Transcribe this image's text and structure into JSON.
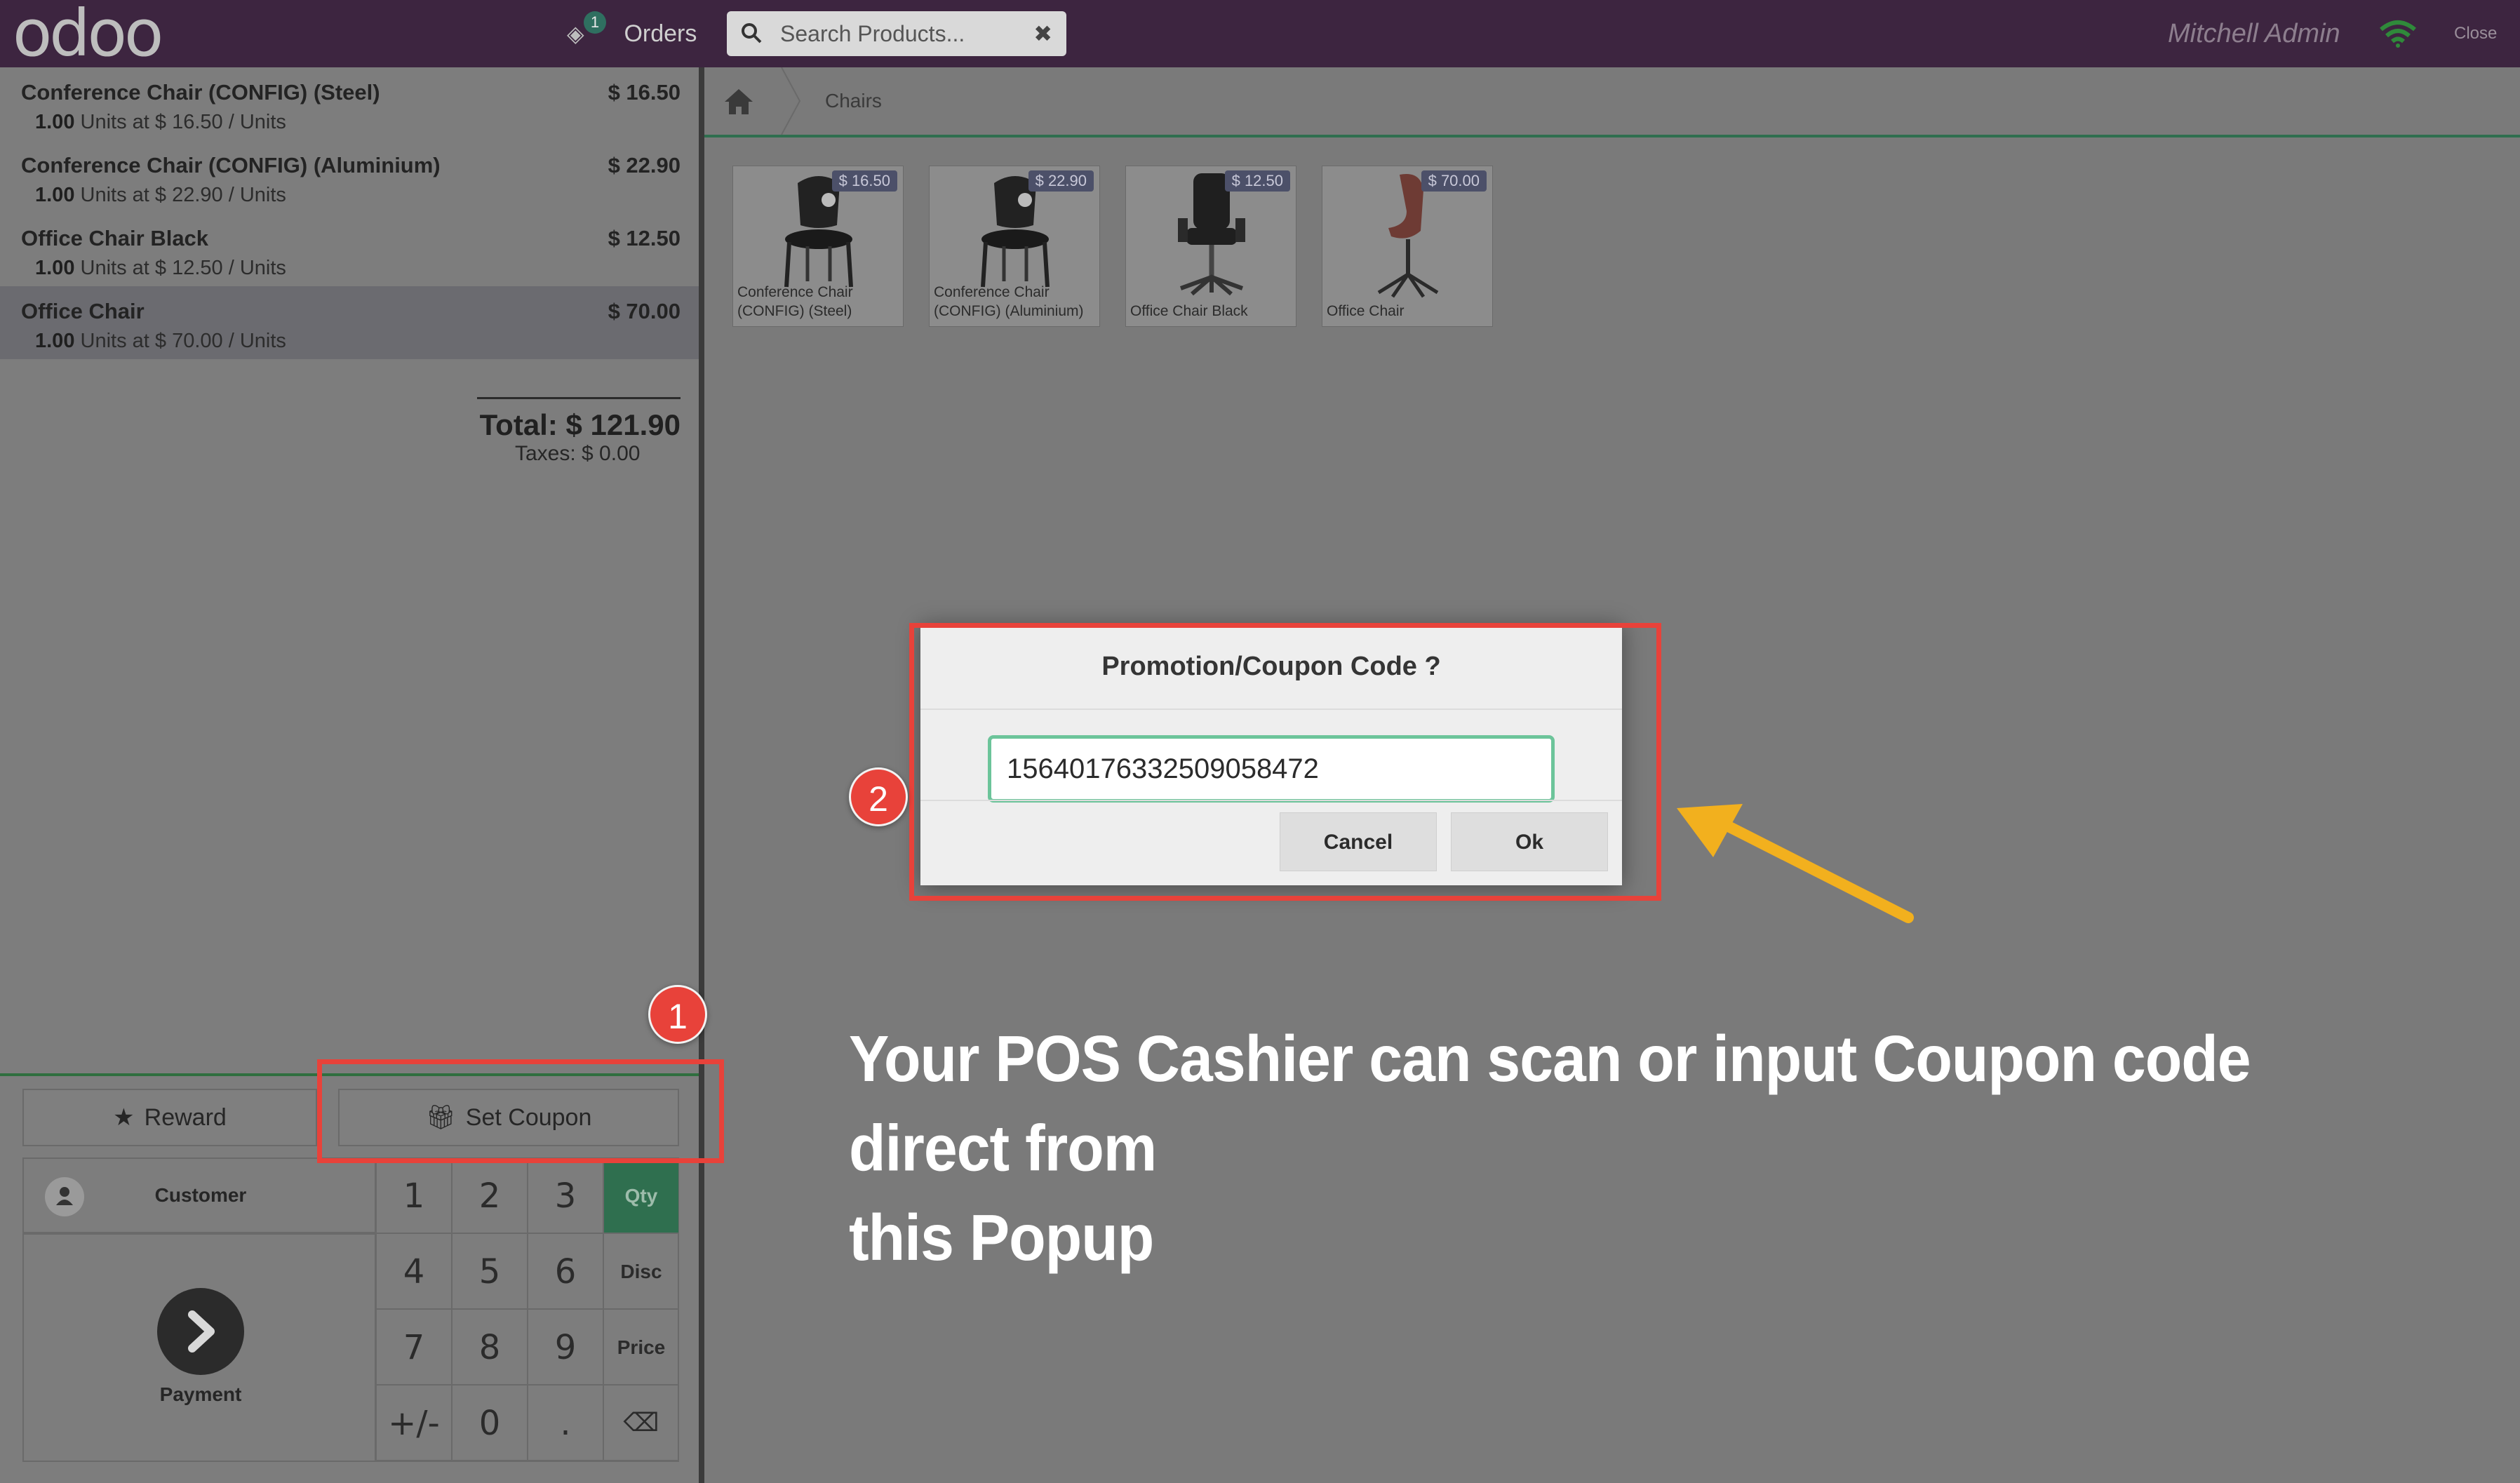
{
  "header": {
    "logo": "odoo",
    "orders_count": "1",
    "orders_label": "Orders",
    "search_placeholder": "Search Products...",
    "search_clear": "✖",
    "user": "Mitchell Admin",
    "close_label": "Close"
  },
  "order": {
    "lines": [
      {
        "name": "Conference Chair (CONFIG) (Steel)",
        "price": "$ 16.50",
        "qty": "1.00",
        "info": "Units at $ 16.50 / Units"
      },
      {
        "name": "Conference Chair (CONFIG) (Aluminium)",
        "price": "$ 22.90",
        "qty": "1.00",
        "info": "Units at $ 22.90 / Units"
      },
      {
        "name": "Office Chair Black",
        "price": "$ 12.50",
        "qty": "1.00",
        "info": "Units at $ 12.50 / Units"
      },
      {
        "name": "Office Chair",
        "price": "$ 70.00",
        "qty": "1.00",
        "info": "Units at $ 70.00 / Units"
      }
    ],
    "total": "Total: $ 121.90",
    "taxes": "Taxes: $ 0.00"
  },
  "controls": {
    "reward": "Reward",
    "set_coupon": "Set Coupon",
    "customer": "Customer",
    "payment": "Payment",
    "keys": [
      "1",
      "2",
      "3",
      "Qty",
      "4",
      "5",
      "6",
      "Disc",
      "7",
      "8",
      "9",
      "Price",
      "+/-",
      "0",
      ".",
      "⌫"
    ],
    "active_mode": "Qty"
  },
  "breadcrumb": {
    "category": "Chairs"
  },
  "products": [
    {
      "name_l1": "Conference Chair",
      "name_l2": "(CONFIG) (Steel)",
      "price": "$ 16.50"
    },
    {
      "name_l1": "Conference Chair",
      "name_l2": "(CONFIG) (Aluminium)",
      "price": "$ 22.90"
    },
    {
      "name_l1": "Office Chair Black",
      "name_l2": "",
      "price": "$ 12.50"
    },
    {
      "name_l1": "Office Chair",
      "name_l2": "",
      "price": "$ 70.00"
    }
  ],
  "popup": {
    "title": "Promotion/Coupon Code ?",
    "value": "15640176332509058472",
    "cancel": "Cancel",
    "ok": "Ok"
  },
  "annotations": {
    "step1": "1",
    "step2": "2",
    "caption_l1": "Your POS Cashier can scan or input Coupon code direct from",
    "caption_l2": "this Popup",
    "colors": {
      "marker": "#e8423a",
      "arrow": "#f2b01e"
    }
  },
  "colors": {
    "header": "#3d2540",
    "accent": "#2f6f4f",
    "input_border": "#6cc49a"
  }
}
